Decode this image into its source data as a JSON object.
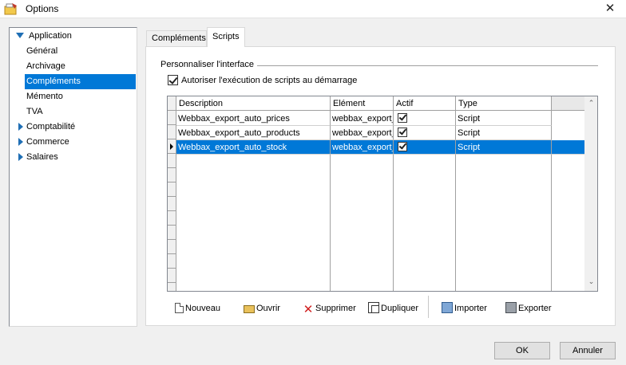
{
  "window": {
    "title": "Options",
    "close_glyph": "✕",
    "app_icon": "app-folder-icon"
  },
  "tree": {
    "items": [
      {
        "label": "Application",
        "level": 0,
        "expanded": true
      },
      {
        "label": "Général",
        "level": 1
      },
      {
        "label": "Archivage",
        "level": 1
      },
      {
        "label": "Compléments",
        "level": 1,
        "selected": true
      },
      {
        "label": "Mémento",
        "level": 1
      },
      {
        "label": "TVA",
        "level": 1
      },
      {
        "label": "Comptabilité",
        "level": 0,
        "expanded": false
      },
      {
        "label": "Commerce",
        "level": 0,
        "expanded": false
      },
      {
        "label": "Salaires",
        "level": 0,
        "expanded": false
      }
    ]
  },
  "tabs": [
    {
      "label": "Compléments",
      "active": false
    },
    {
      "label": "Scripts",
      "active": true
    }
  ],
  "scripts_panel": {
    "group_label": "Personnaliser l'interface",
    "autorun_checkbox": {
      "label": "Autoriser l'exécution de scripts au démarrage",
      "checked": true
    }
  },
  "grid": {
    "columns": [
      "Description",
      "Elément",
      "Actif",
      "Type"
    ],
    "rows": [
      {
        "description": "Webbax_export_auto_prices",
        "element": "webbax_export_",
        "active": true,
        "type": "Script",
        "selected": false
      },
      {
        "description": "Webbax_export_auto_products",
        "element": "webbax_export_",
        "active": true,
        "type": "Script",
        "selected": false
      },
      {
        "description": "Webbax_export_auto_stock",
        "element": "webbax_export_",
        "active": true,
        "type": "Script",
        "selected": true
      }
    ],
    "scroll_up_glyph": "⌃",
    "scroll_down_glyph": "⌄"
  },
  "toolbar": {
    "new_label": "Nouveau",
    "open_label": "Ouvrir",
    "delete_label": "Supprimer",
    "duplicate_label": "Dupliquer",
    "import_label": "Importer",
    "export_label": "Exporter",
    "delete_glyph": "✕"
  },
  "footer": {
    "ok_label": "OK",
    "cancel_label": "Annuler"
  },
  "colors": {
    "selection": "#0078d7",
    "tree_arrow": "#1f6fb5"
  }
}
